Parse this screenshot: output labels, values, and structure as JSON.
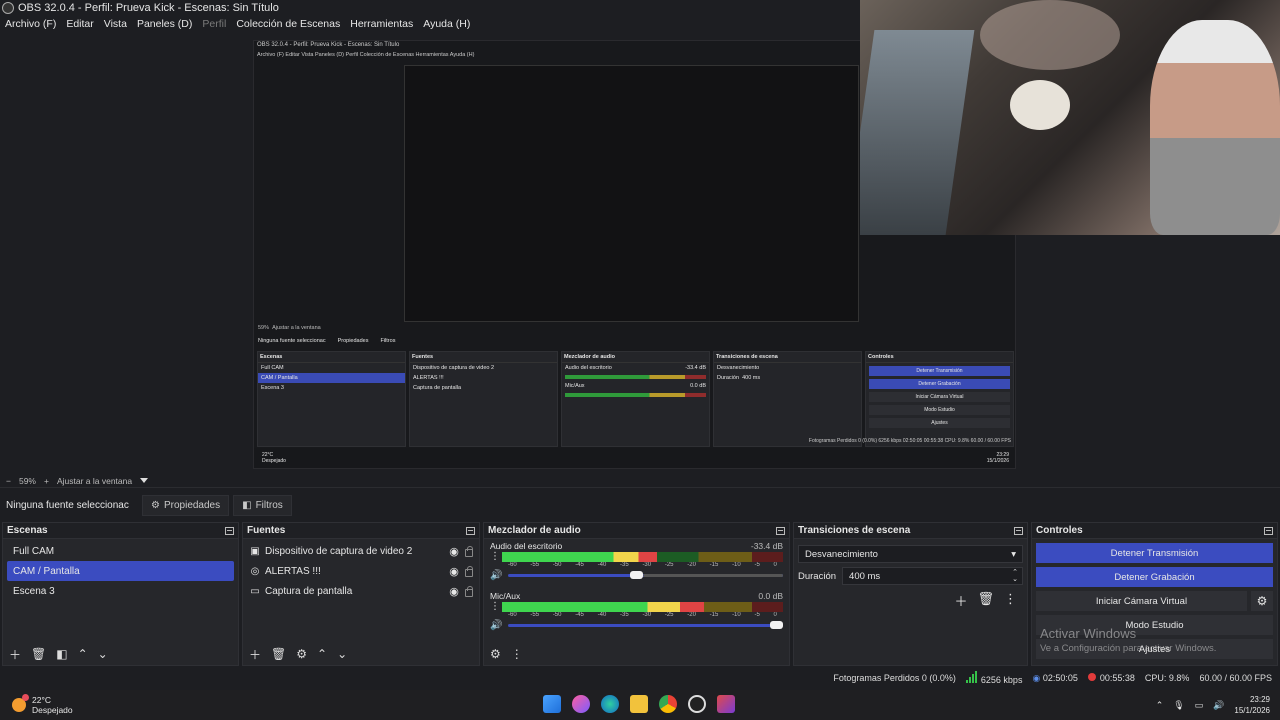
{
  "window": {
    "title": "OBS 32.0.4 - Perfil: Prueva Kick - Escenas: Sin Título"
  },
  "menu": [
    "Archivo (F)",
    "Editar",
    "Vista",
    "Paneles (D)",
    "Perfil",
    "Colección de Escenas",
    "Herramientas",
    "Ayuda (H)"
  ],
  "nested": {
    "title": "OBS 32.0.4 - Perfil: Prueva Kick - Escenas: Sin Título",
    "menu": "Archivo (F)   Editar   Vista   Paneles (D)   Perfil   Colección de Escenas   Herramientas   Ayuda (H)",
    "zoom": "59%",
    "fit": "Ajustar a la ventana",
    "nosel": "Ninguna fuente seleccionac",
    "props": "Propiedades",
    "filters": "Filtros",
    "scenes_head": "Escenas",
    "sources_head": "Fuentes",
    "mixer_head": "Mezclador de audio",
    "trans_head": "Transiciones de escena",
    "ctrl_head": "Controles",
    "scenes": [
      "Full CAM",
      "CAM / Pantalla",
      "Escena 3"
    ],
    "sources": [
      "Dispositivo de captura de video 2",
      "ALERTAS !!!",
      "Captura de pantalla"
    ],
    "track1": "Audio del escritorio",
    "track1_db": "-33.4 dB",
    "track2": "Mic/Aux",
    "track2_db": "0.0 dB",
    "transition": "Desvanecimiento",
    "duration_label": "Duración",
    "duration": "400 ms",
    "btn_stop_stream": "Detener Transmisión",
    "btn_stop_rec": "Detener Grabación",
    "btn_vcam": "Iniciar Cámara Virtual",
    "btn_studio": "Modo Estudio",
    "btn_settings": "Ajustes",
    "status": "Fotogramas Perdidos 0 (0.0%)   6256 kbps   02:50:05   00:55:38   CPU: 9.8%   60.00 / 60.00 FPS",
    "weather_temp": "22°C",
    "weather_desc": "Despejado",
    "time": "23:29",
    "date": "15/1/2026"
  },
  "zoombar": {
    "minus": "−",
    "zoom": "59%",
    "plus": "+",
    "fit": "Ajustar a la ventana"
  },
  "sourcebar": {
    "nosel": "Ninguna fuente seleccionac",
    "props": "Propiedades",
    "filters": "Filtros"
  },
  "scenes": {
    "title": "Escenas",
    "items": [
      "Full CAM",
      "CAM / Pantalla",
      "Escena 3"
    ],
    "selected_index": 1
  },
  "sources": {
    "title": "Fuentes",
    "items": [
      {
        "label": "Dispositivo de captura de video 2",
        "icon": "camera-icon"
      },
      {
        "label": "ALERTAS !!!",
        "icon": "browser-icon"
      },
      {
        "label": "Captura de pantalla",
        "icon": "monitor-icon"
      }
    ]
  },
  "mixer": {
    "title": "Mezclador de audio",
    "ticks": [
      "-60",
      "-55",
      "-50",
      "-45",
      "-40",
      "-35",
      "-30",
      "-25",
      "-20",
      "-15",
      "-10",
      "-5",
      "0"
    ],
    "tracks": [
      {
        "name": "Audio del escritorio",
        "db": "-33.4 dB",
        "level": 0.55,
        "volume": 0.49
      },
      {
        "name": "Mic/Aux",
        "db": "0.0 dB",
        "level": 0.72,
        "volume": 1.0
      }
    ]
  },
  "transitions": {
    "title": "Transiciones de escena",
    "selected": "Desvanecimiento",
    "duration_label": "Duración",
    "duration": "400 ms"
  },
  "controls": {
    "title": "Controles",
    "stop_stream": "Detener Transmisión",
    "stop_record": "Detener Grabación",
    "virtual_cam": "Iniciar Cámara Virtual",
    "studio_mode": "Modo Estudio",
    "settings": "Ajustes"
  },
  "watermark": {
    "line1": "Activar Windows",
    "line2": "Ve a Configuración para activar Windows."
  },
  "status": {
    "dropped": "Fotogramas Perdidos 0 (0.0%)",
    "bitrate": "6256 kbps",
    "stream_time": "02:50:05",
    "rec_time": "00:55:38",
    "cpu": "CPU: 9.8%",
    "fps": "60.00 / 60.00 FPS"
  },
  "taskbar": {
    "temp": "22°C",
    "weather": "Despejado",
    "time": "23:29",
    "date": "15/1/2026"
  }
}
